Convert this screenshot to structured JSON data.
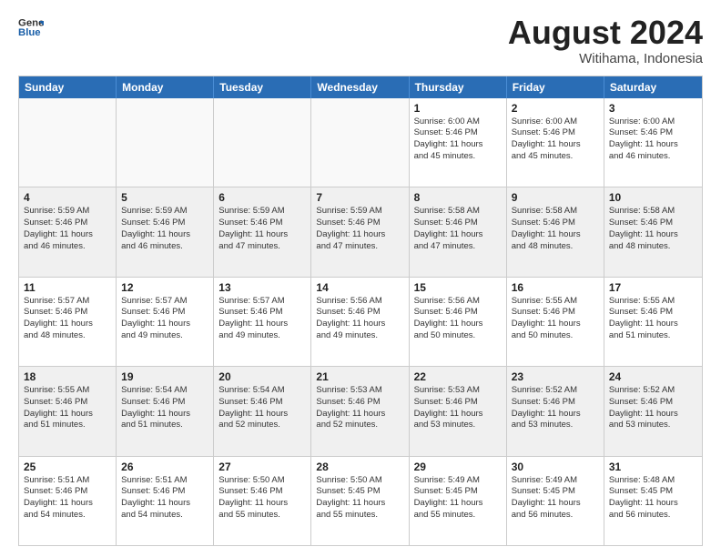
{
  "header": {
    "logo_general": "General",
    "logo_blue": "Blue",
    "month_title": "August 2024",
    "location": "Witihama, Indonesia"
  },
  "weekdays": [
    "Sunday",
    "Monday",
    "Tuesday",
    "Wednesday",
    "Thursday",
    "Friday",
    "Saturday"
  ],
  "rows": [
    [
      {
        "day": "",
        "info": ""
      },
      {
        "day": "",
        "info": ""
      },
      {
        "day": "",
        "info": ""
      },
      {
        "day": "",
        "info": ""
      },
      {
        "day": "1",
        "info": "Sunrise: 6:00 AM\nSunset: 5:46 PM\nDaylight: 11 hours\nand 45 minutes."
      },
      {
        "day": "2",
        "info": "Sunrise: 6:00 AM\nSunset: 5:46 PM\nDaylight: 11 hours\nand 45 minutes."
      },
      {
        "day": "3",
        "info": "Sunrise: 6:00 AM\nSunset: 5:46 PM\nDaylight: 11 hours\nand 46 minutes."
      }
    ],
    [
      {
        "day": "4",
        "info": "Sunrise: 5:59 AM\nSunset: 5:46 PM\nDaylight: 11 hours\nand 46 minutes."
      },
      {
        "day": "5",
        "info": "Sunrise: 5:59 AM\nSunset: 5:46 PM\nDaylight: 11 hours\nand 46 minutes."
      },
      {
        "day": "6",
        "info": "Sunrise: 5:59 AM\nSunset: 5:46 PM\nDaylight: 11 hours\nand 47 minutes."
      },
      {
        "day": "7",
        "info": "Sunrise: 5:59 AM\nSunset: 5:46 PM\nDaylight: 11 hours\nand 47 minutes."
      },
      {
        "day": "8",
        "info": "Sunrise: 5:58 AM\nSunset: 5:46 PM\nDaylight: 11 hours\nand 47 minutes."
      },
      {
        "day": "9",
        "info": "Sunrise: 5:58 AM\nSunset: 5:46 PM\nDaylight: 11 hours\nand 48 minutes."
      },
      {
        "day": "10",
        "info": "Sunrise: 5:58 AM\nSunset: 5:46 PM\nDaylight: 11 hours\nand 48 minutes."
      }
    ],
    [
      {
        "day": "11",
        "info": "Sunrise: 5:57 AM\nSunset: 5:46 PM\nDaylight: 11 hours\nand 48 minutes."
      },
      {
        "day": "12",
        "info": "Sunrise: 5:57 AM\nSunset: 5:46 PM\nDaylight: 11 hours\nand 49 minutes."
      },
      {
        "day": "13",
        "info": "Sunrise: 5:57 AM\nSunset: 5:46 PM\nDaylight: 11 hours\nand 49 minutes."
      },
      {
        "day": "14",
        "info": "Sunrise: 5:56 AM\nSunset: 5:46 PM\nDaylight: 11 hours\nand 49 minutes."
      },
      {
        "day": "15",
        "info": "Sunrise: 5:56 AM\nSunset: 5:46 PM\nDaylight: 11 hours\nand 50 minutes."
      },
      {
        "day": "16",
        "info": "Sunrise: 5:55 AM\nSunset: 5:46 PM\nDaylight: 11 hours\nand 50 minutes."
      },
      {
        "day": "17",
        "info": "Sunrise: 5:55 AM\nSunset: 5:46 PM\nDaylight: 11 hours\nand 51 minutes."
      }
    ],
    [
      {
        "day": "18",
        "info": "Sunrise: 5:55 AM\nSunset: 5:46 PM\nDaylight: 11 hours\nand 51 minutes."
      },
      {
        "day": "19",
        "info": "Sunrise: 5:54 AM\nSunset: 5:46 PM\nDaylight: 11 hours\nand 51 minutes."
      },
      {
        "day": "20",
        "info": "Sunrise: 5:54 AM\nSunset: 5:46 PM\nDaylight: 11 hours\nand 52 minutes."
      },
      {
        "day": "21",
        "info": "Sunrise: 5:53 AM\nSunset: 5:46 PM\nDaylight: 11 hours\nand 52 minutes."
      },
      {
        "day": "22",
        "info": "Sunrise: 5:53 AM\nSunset: 5:46 PM\nDaylight: 11 hours\nand 53 minutes."
      },
      {
        "day": "23",
        "info": "Sunrise: 5:52 AM\nSunset: 5:46 PM\nDaylight: 11 hours\nand 53 minutes."
      },
      {
        "day": "24",
        "info": "Sunrise: 5:52 AM\nSunset: 5:46 PM\nDaylight: 11 hours\nand 53 minutes."
      }
    ],
    [
      {
        "day": "25",
        "info": "Sunrise: 5:51 AM\nSunset: 5:46 PM\nDaylight: 11 hours\nand 54 minutes."
      },
      {
        "day": "26",
        "info": "Sunrise: 5:51 AM\nSunset: 5:46 PM\nDaylight: 11 hours\nand 54 minutes."
      },
      {
        "day": "27",
        "info": "Sunrise: 5:50 AM\nSunset: 5:46 PM\nDaylight: 11 hours\nand 55 minutes."
      },
      {
        "day": "28",
        "info": "Sunrise: 5:50 AM\nSunset: 5:45 PM\nDaylight: 11 hours\nand 55 minutes."
      },
      {
        "day": "29",
        "info": "Sunrise: 5:49 AM\nSunset: 5:45 PM\nDaylight: 11 hours\nand 55 minutes."
      },
      {
        "day": "30",
        "info": "Sunrise: 5:49 AM\nSunset: 5:45 PM\nDaylight: 11 hours\nand 56 minutes."
      },
      {
        "day": "31",
        "info": "Sunrise: 5:48 AM\nSunset: 5:45 PM\nDaylight: 11 hours\nand 56 minutes."
      }
    ]
  ]
}
